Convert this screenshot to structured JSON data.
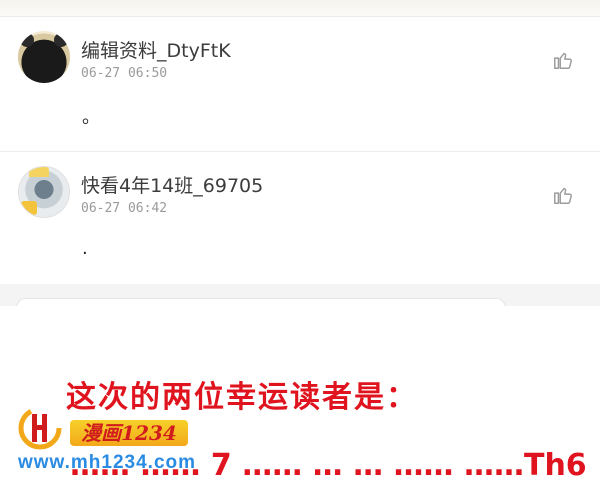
{
  "comments": [
    {
      "username": "编辑资料_DtyFtK",
      "time": "06-27 06:50",
      "content": "。",
      "avatar_icon": "user-avatar-icon",
      "like_icon": "thumbs-up-icon"
    },
    {
      "username": "快看4年14班_69705",
      "time": "06-27 06:42",
      "content": ".",
      "avatar_icon": "user-avatar-icon",
      "like_icon": "thumbs-up-icon"
    }
  ],
  "announcement": {
    "headline": "这次的两位幸运读者是：",
    "names_partial": "…… …… 7 …… … … …… ……Th6",
    "color": "#e0141e"
  },
  "watermark": {
    "badge_text": "漫画1234",
    "url_text": "www.mh1234.com",
    "badge_color": "#f2a81a",
    "url_color": "#2a8be3"
  }
}
